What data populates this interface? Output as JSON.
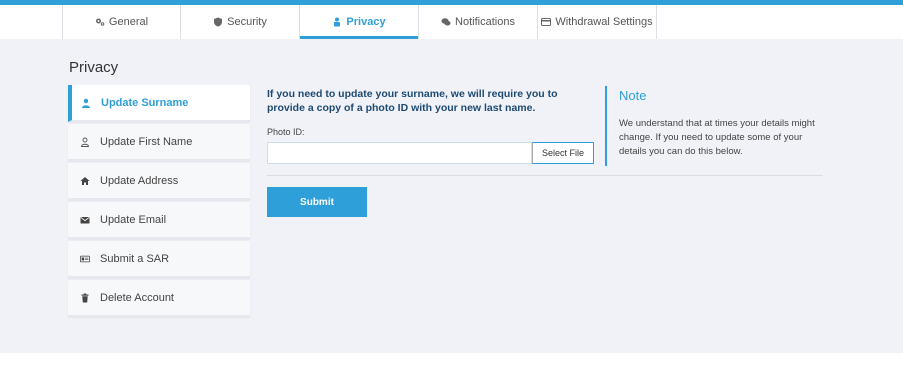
{
  "tabs": [
    {
      "label": "General",
      "icon": "gears-icon"
    },
    {
      "label": "Security",
      "icon": "shield-icon"
    },
    {
      "label": "Privacy",
      "icon": "user-lock-icon",
      "active": true
    },
    {
      "label": "Notifications",
      "icon": "chat-icon"
    },
    {
      "label": "Withdrawal Settings",
      "icon": "card-icon"
    }
  ],
  "page": {
    "title": "Privacy"
  },
  "sidebar": {
    "items": [
      {
        "label": "Update Surname",
        "icon": "user-icon",
        "active": true
      },
      {
        "label": "Update First Name",
        "icon": "user-outline-icon"
      },
      {
        "label": "Update Address",
        "icon": "home-icon"
      },
      {
        "label": "Update Email",
        "icon": "envelope-icon"
      },
      {
        "label": "Submit a SAR",
        "icon": "id-card-icon"
      },
      {
        "label": "Delete Account",
        "icon": "trash-icon"
      }
    ]
  },
  "form": {
    "intro": "If you need to update your surname, we will require you to provide a copy of a photo ID with your new last name.",
    "photo_label": "Photo ID:",
    "photo_value": "",
    "select_file": "Select File",
    "submit": "Submit"
  },
  "note": {
    "title": "Note",
    "text": "We understand that at times your details might change. If you need to update some of your details you can do this below."
  },
  "colors": {
    "accent": "#2e9fd8",
    "background": "#f0f2f7",
    "heading": "#1e4a72"
  }
}
